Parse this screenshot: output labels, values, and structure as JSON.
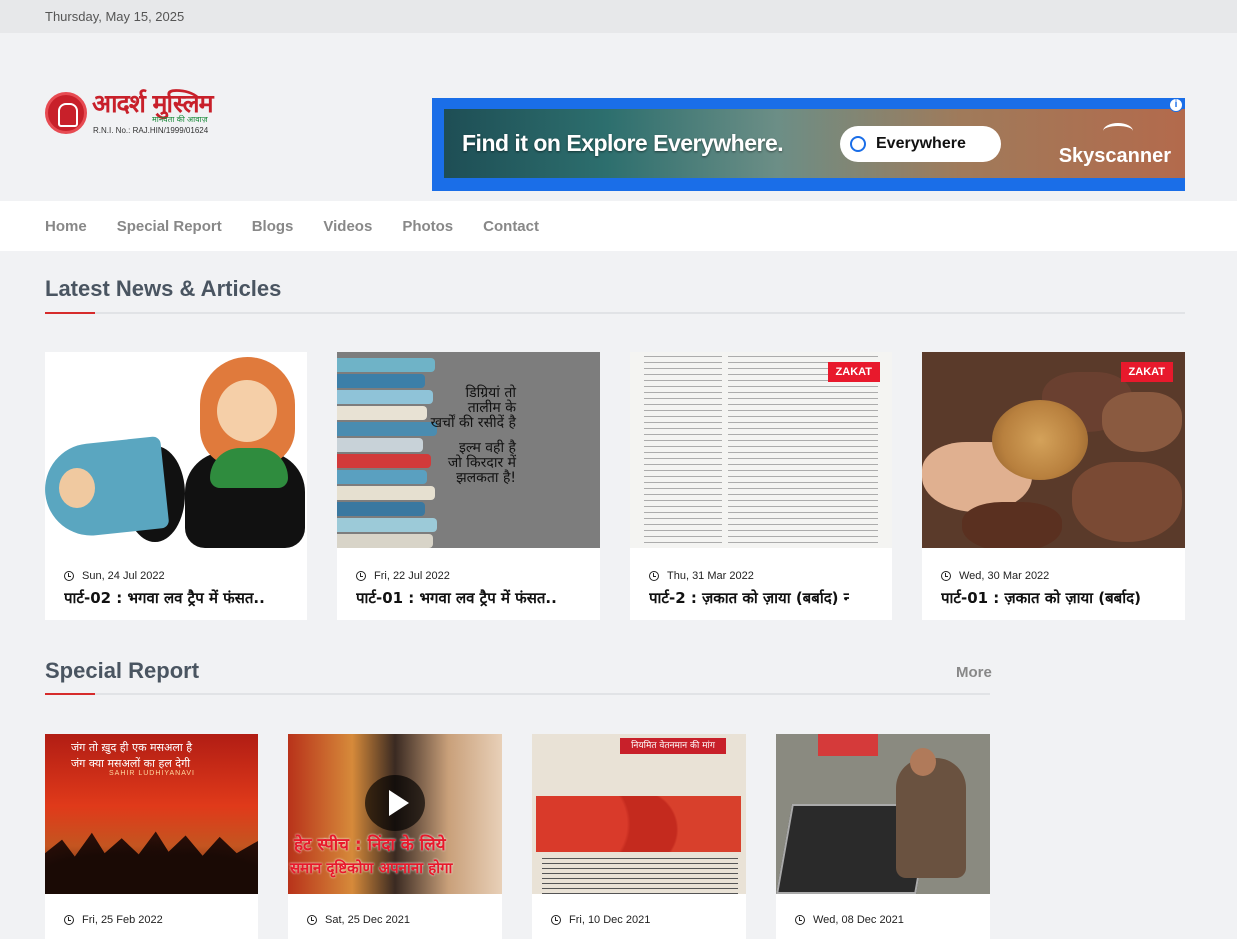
{
  "topbar": {
    "date": "Thursday, May 15, 2025"
  },
  "logo": {
    "name": "आदर्श मुस्लिम",
    "tagline": "मानवता की आवाज़",
    "rni": "R.N.I. No.: RAJ.HIN/1999/01624"
  },
  "ad": {
    "headline": "Find it on Explore Everywhere.",
    "search_value": "Everywhere",
    "brand": "Skyscanner",
    "info": "i"
  },
  "nav": {
    "items": [
      "Home",
      "Special Report",
      "Blogs",
      "Videos",
      "Photos",
      "Contact"
    ]
  },
  "latest": {
    "title": "Latest News & Articles",
    "cards": [
      {
        "date": "Sun, 24 Jul 2022",
        "title": "पार्ट-02 : भगवा लव ट्रैप में फंसत...",
        "badge": ""
      },
      {
        "date": "Fri, 22 Jul 2022",
        "title": "पार्ट-01 : भगवा लव ट्रैप में फंसत...",
        "badge": "",
        "quote": [
          "डिग्रियां तो",
          "तालीम के",
          "खर्चों की रसीदें है",
          "",
          "इल्म वही है",
          "जो किरदार में",
          "झलकता है!"
        ]
      },
      {
        "date": "Thu, 31 Mar 2022",
        "title": "पार्ट-2 : ज़कात को ज़ाया (बर्बाद) न ...",
        "badge": "ZAKAT"
      },
      {
        "date": "Wed, 30 Mar 2022",
        "title": "पार्ट-01 : ज़कात को ज़ाया (बर्बाद) न ...",
        "badge": "ZAKAT"
      }
    ]
  },
  "special": {
    "title": "Special Report",
    "more": "More",
    "cards": [
      {
        "date": "Fri, 25 Feb 2022",
        "art_text": [
          "जंग तो ख़ुद ही एक मसअला है",
          "जंग क्या मसअलों का हल देगी"
        ],
        "art_sub": "SAHIR LUDHIYANAVI"
      },
      {
        "date": "Sat, 25 Dec 2021",
        "cap1": "हेट स्पीच : निंदा के लिये",
        "cap2": "समान दृष्टिकोण अपनाना होगा"
      },
      {
        "date": "Fri, 10 Dec 2021",
        "banner": "नियमित वेतनमान की मांग"
      },
      {
        "date": "Wed, 08 Dec 2021"
      }
    ]
  },
  "colors": {
    "accent": "#d62b2b",
    "badge": "#e8192c",
    "ad_border": "#1a6ee8"
  }
}
